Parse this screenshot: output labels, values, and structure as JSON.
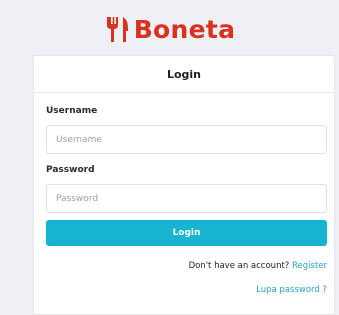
{
  "brand": {
    "name": "Boneta",
    "icon": "fork-knife-icon",
    "color": "#d9321f"
  },
  "login_form": {
    "title": "Login",
    "username": {
      "label": "Username",
      "placeholder": "Username",
      "value": ""
    },
    "password": {
      "label": "Password",
      "placeholder": "Password",
      "value": ""
    },
    "submit_label": "Login",
    "submit_color": "#17b4d2",
    "register_prompt": "Don't have an account?",
    "register_link": "Register",
    "forgot_link": "Lupa password ?",
    "link_color": "#2a9fd0"
  }
}
